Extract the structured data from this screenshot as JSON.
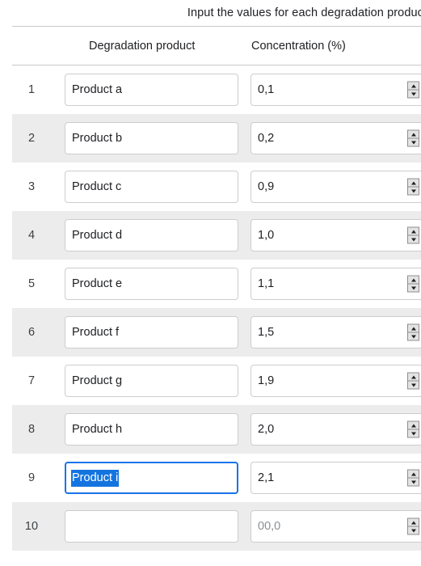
{
  "instruction": {
    "text": "Input the values for each degradation product"
  },
  "table": {
    "columns": {
      "index": "",
      "name": "Degradation product",
      "concentration": "Concentration (%)"
    },
    "concentration_placeholder": "00,0",
    "rows": [
      {
        "index": "1",
        "name": "Product a",
        "concentration": "0,1"
      },
      {
        "index": "2",
        "name": "Product b",
        "concentration": "0,2"
      },
      {
        "index": "3",
        "name": "Product c",
        "concentration": "0,9"
      },
      {
        "index": "4",
        "name": "Product d",
        "concentration": "1,0"
      },
      {
        "index": "5",
        "name": "Product e",
        "concentration": "1,1"
      },
      {
        "index": "6",
        "name": "Product f",
        "concentration": "1,5"
      },
      {
        "index": "7",
        "name": "Product g",
        "concentration": "1,9"
      },
      {
        "index": "8",
        "name": "Product h",
        "concentration": "2,0"
      },
      {
        "index": "9",
        "name": "Product i",
        "concentration": "2,1"
      },
      {
        "index": "10",
        "name": "",
        "concentration": ""
      }
    ]
  },
  "state": {
    "focused_row_index": 8,
    "selected_text": "Product i"
  },
  "colors": {
    "focus_border": "#1a73e8",
    "selection_background": "#1374e0",
    "stripe_background": "#ececec",
    "input_border": "#cdcdcd",
    "rule": "#c6c9cc",
    "placeholder_text": "#8a8f94",
    "body_text": "#202124"
  },
  "icons": {
    "spinner_up": "triangle-up-icon",
    "spinner_down": "triangle-down-icon"
  }
}
